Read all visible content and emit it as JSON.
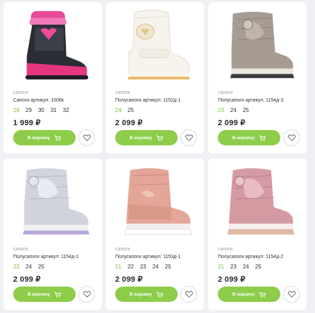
{
  "products": [
    {
      "category": "сапоги",
      "title": "Сапоги артикул: 1008к",
      "sizes": [
        "28",
        "29",
        "30",
        "31",
        "32"
      ],
      "price": "1 999 ₽",
      "cart_label": "В корзину",
      "image": "pink-black-winter-boot"
    },
    {
      "category": "сапоги",
      "title": "Полусапоги артикул: 1152д-1",
      "sizes": [
        "24",
        "25"
      ],
      "price": "2 099 ₽",
      "cart_label": "В корзину",
      "image": "white-heart-moon-boot"
    },
    {
      "category": "сапоги",
      "title": "Полусапоги артикул: 1154д-3",
      "sizes": [
        "23",
        "24",
        "25"
      ],
      "price": "2 099 ₽",
      "cart_label": "В корзину",
      "image": "bronze-metallic-moon-boot"
    },
    {
      "category": "сапоги",
      "title": "Полусапоги артикул: 1154д-1",
      "sizes": [
        "23",
        "24",
        "25"
      ],
      "price": "2 099 ₽",
      "cart_label": "В корзину",
      "image": "silver-metallic-moon-boot"
    },
    {
      "category": "сапоги",
      "title": "Полусапоги артикул: 1153д-1",
      "sizes": [
        "21",
        "22",
        "23",
        "24",
        "25"
      ],
      "price": "2 099 ₽",
      "cart_label": "В корзину",
      "image": "pink-sequin-boot"
    },
    {
      "category": "сапоги",
      "title": "Полусапоги артикул: 1154д-2",
      "sizes": [
        "21",
        "23",
        "24",
        "25"
      ],
      "price": "2 099 ₽",
      "cart_label": "В корзину",
      "image": "rose-metallic-moon-boot"
    }
  ],
  "colors": {
    "accent": "#8dcd4a",
    "size_available": "#7cc13b",
    "background": "#eef0f4"
  },
  "icons": {
    "cart": "cart-icon",
    "favorite": "heart-icon"
  }
}
